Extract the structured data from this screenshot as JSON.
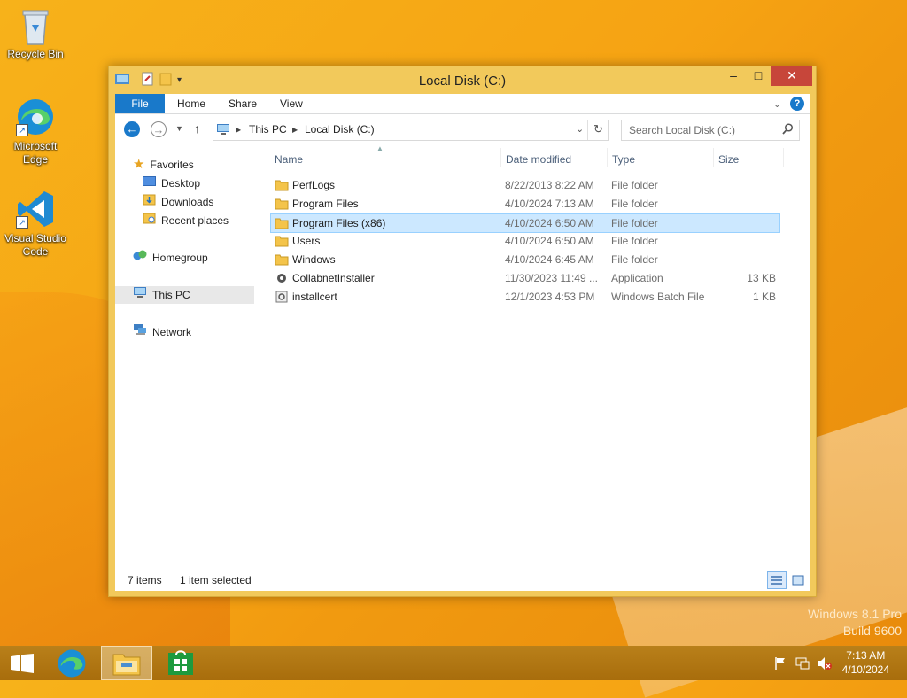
{
  "desktop": {
    "icons": [
      {
        "label": "Recycle Bin",
        "icon": "recycle-bin-icon"
      },
      {
        "label": "Microsoft Edge",
        "icon": "edge-icon"
      },
      {
        "label": "Visual Studio Code",
        "icon": "vscode-icon"
      }
    ],
    "watermark": {
      "line1": "Windows 8.1 Pro",
      "line2": "Build 9600"
    }
  },
  "window": {
    "title": "Local Disk (C:)",
    "controls": {
      "minimize": "–",
      "maximize": "□",
      "close": "✕"
    }
  },
  "ribbon": {
    "tabs": [
      {
        "label": "File"
      },
      {
        "label": "Home"
      },
      {
        "label": "Share"
      },
      {
        "label": "View"
      }
    ],
    "help": "?"
  },
  "address": {
    "crumbs": [
      "This PC",
      "Local Disk (C:)"
    ]
  },
  "search": {
    "placeholder": "Search Local Disk (C:)"
  },
  "navigation": {
    "favorites": "Favorites",
    "favorites_items": [
      "Desktop",
      "Downloads",
      "Recent places"
    ],
    "homegroup": "Homegroup",
    "this_pc": "This PC",
    "network": "Network"
  },
  "columns": {
    "name": "Name",
    "date": "Date modified",
    "type": "Type",
    "size": "Size"
  },
  "files": [
    {
      "name": "PerfLogs",
      "date": "8/22/2013 8:22 AM",
      "type": "File folder",
      "size": "",
      "icon": "folder-icon"
    },
    {
      "name": "Program Files",
      "date": "4/10/2024 7:13 AM",
      "type": "File folder",
      "size": "",
      "icon": "folder-icon"
    },
    {
      "name": "Program Files (x86)",
      "date": "4/10/2024 6:50 AM",
      "type": "File folder",
      "size": "",
      "icon": "folder-icon",
      "selected": true
    },
    {
      "name": "Users",
      "date": "4/10/2024 6:50 AM",
      "type": "File folder",
      "size": "",
      "icon": "folder-icon"
    },
    {
      "name": "Windows",
      "date": "4/10/2024 6:45 AM",
      "type": "File folder",
      "size": "",
      "icon": "folder-icon"
    },
    {
      "name": "CollabnetInstaller",
      "date": "11/30/2023 11:49 ...",
      "type": "Application",
      "size": "13 KB",
      "icon": "application-icon"
    },
    {
      "name": "installcert",
      "date": "12/1/2023 4:53 PM",
      "type": "Windows Batch File",
      "size": "1 KB",
      "icon": "batch-file-icon"
    }
  ],
  "status": {
    "count": "7 items",
    "selected": "1 item selected"
  },
  "taskbar": {
    "apps": [
      "start-icon",
      "edge-icon",
      "file-explorer-icon",
      "store-icon"
    ],
    "time": "7:13 AM",
    "date": "4/10/2024"
  },
  "colors": {
    "accent": "#1979ca",
    "window_frame": "#f2c95b",
    "close": "#c7463a",
    "selection": "#cce8ff"
  }
}
